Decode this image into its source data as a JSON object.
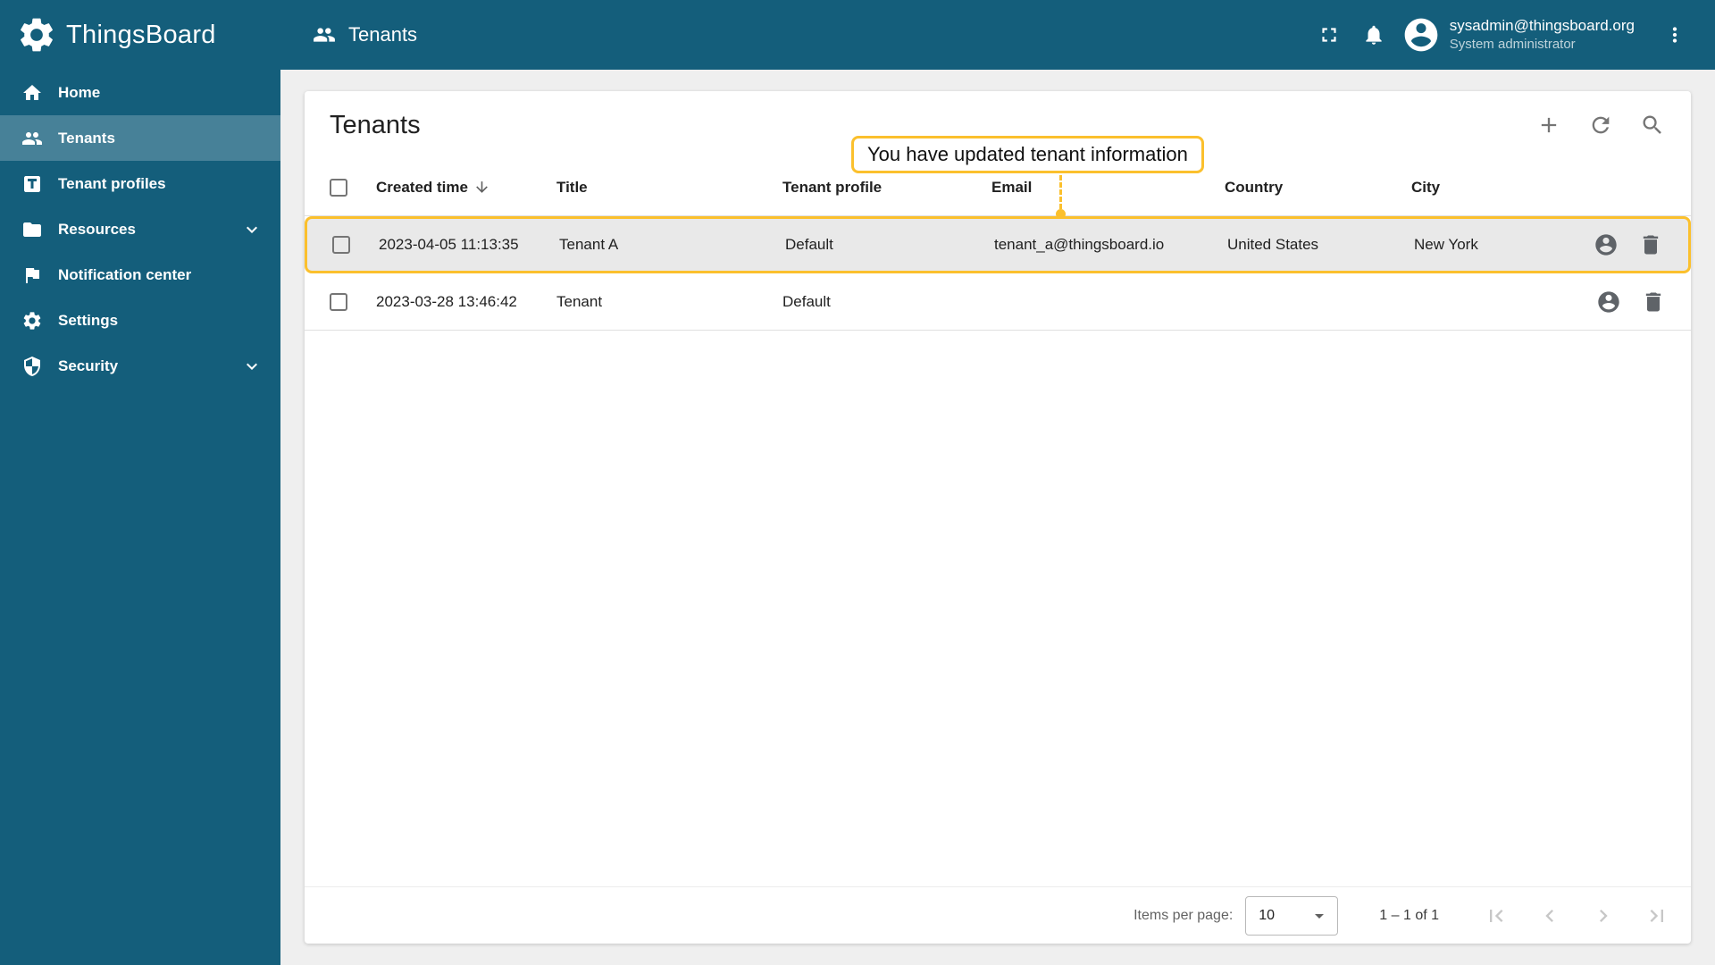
{
  "colors": {
    "primary": "#145E7B",
    "accent_yellow": "#FBC02D",
    "content_bg": "#EFEFEF",
    "selected_row_bg": "#E9E9E9"
  },
  "sidebar": {
    "logo_text": "ThingsBoard",
    "items": [
      {
        "label": "Home",
        "icon": "home-icon",
        "selected": false,
        "expandable": false
      },
      {
        "label": "Tenants",
        "icon": "tenants-icon",
        "selected": true,
        "expandable": false
      },
      {
        "label": "Tenant profiles",
        "icon": "tenant-profiles-icon",
        "selected": false,
        "expandable": false
      },
      {
        "label": "Resources",
        "icon": "folder-icon",
        "selected": false,
        "expandable": true
      },
      {
        "label": "Notification center",
        "icon": "flag-icon",
        "selected": false,
        "expandable": false
      },
      {
        "label": "Settings",
        "icon": "gear-icon",
        "selected": false,
        "expandable": false
      },
      {
        "label": "Security",
        "icon": "shield-icon",
        "selected": false,
        "expandable": true
      }
    ]
  },
  "topbar": {
    "title": "Tenants",
    "user_email": "sysadmin@thingsboard.org",
    "user_role": "System administrator"
  },
  "page": {
    "card_title": "Tenants",
    "callout_text": "You have updated tenant information",
    "table": {
      "headers": {
        "created_time": "Created time",
        "title": "Title",
        "tenant_profile": "Tenant profile",
        "email": "Email",
        "country": "Country",
        "city": "City"
      },
      "rows": [
        {
          "created_time": "2023-04-05 11:13:35",
          "title": "Tenant A",
          "tenant_profile": "Default",
          "email": "tenant_a@thingsboard.io",
          "country": "United States",
          "city": "New York",
          "highlighted": true
        },
        {
          "created_time": "2023-03-28 13:46:42",
          "title": "Tenant",
          "tenant_profile": "Default",
          "email": "",
          "country": "",
          "city": "",
          "highlighted": false
        }
      ]
    },
    "paginator": {
      "items_per_page_label": "Items per page:",
      "items_per_page_value": "10",
      "range_label": "1 – 1 of 1"
    }
  }
}
